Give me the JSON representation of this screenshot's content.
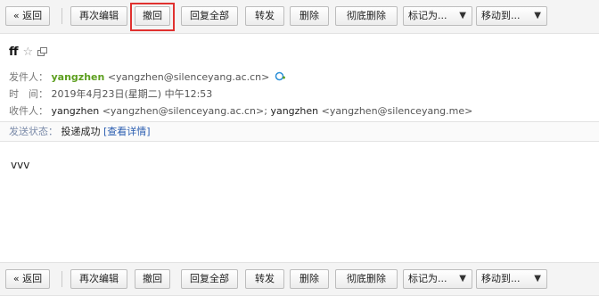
{
  "toolbar": {
    "back_label": "« 返回",
    "reedit_label": "再次编辑",
    "recall_label": "撤回",
    "reply_all_label": "回复全部",
    "forward_label": "转发",
    "delete_label": "删除",
    "purge_label": "彻底删除",
    "mark_as_label": "标记为...",
    "move_to_label": "移动到..."
  },
  "message": {
    "subject": "ff",
    "from_label": "发件人：",
    "from_name": "yangzhen",
    "from_address": "<yangzhen@silenceyang.ac.cn>",
    "time_label": "时　间：",
    "time_value": "2019年4月23日(星期二) 中午12:53",
    "to_label": "收件人：",
    "to_name_1": "yangzhen",
    "to_address_1": "<yangzhen@silenceyang.ac.cn>;",
    "to_name_2": "yangzhen",
    "to_address_2": "<yangzhen@silenceyang.me>",
    "status_label": "发送状态：",
    "status_value": "投递成功",
    "status_link": "[查看详情]",
    "body": "vvv"
  },
  "icons": {
    "star": "star-icon",
    "popout": "popout-icon",
    "add_contact": "add-contact-icon",
    "dropdown": "chevron-down-icon"
  },
  "colors": {
    "sender": "#5d9f1f",
    "link": "#2a5db0",
    "highlight": "#e0312f"
  }
}
